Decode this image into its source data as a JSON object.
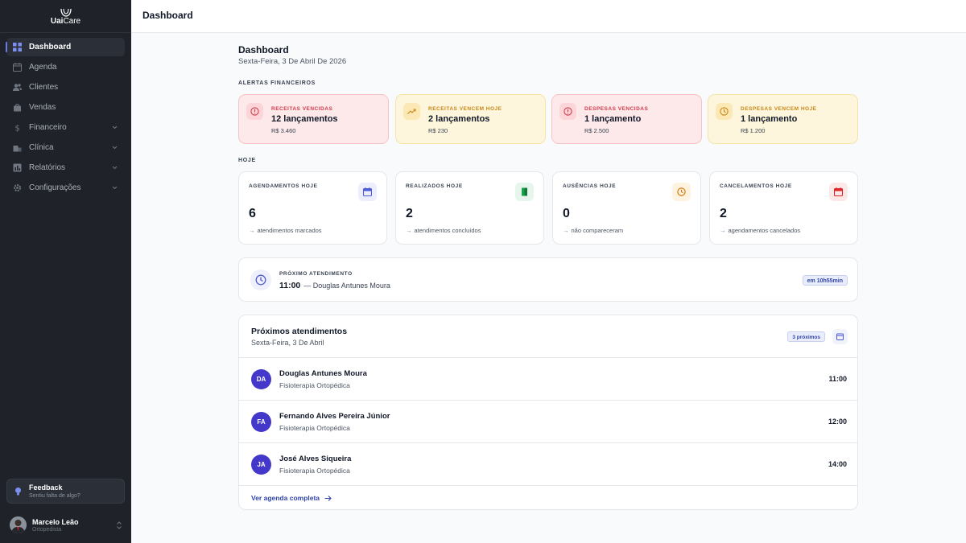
{
  "sidebar": {
    "logo": {
      "brand_bold": "Uai",
      "brand_light": "Care"
    },
    "items": [
      {
        "label": "Dashboard",
        "icon": "grid-icon"
      },
      {
        "label": "Agenda",
        "icon": "calendar-icon"
      },
      {
        "label": "Clientes",
        "icon": "users-icon"
      },
      {
        "label": "Vendas",
        "icon": "shopping-bag-icon"
      },
      {
        "label": "Financeiro",
        "icon": "dollar-icon"
      },
      {
        "label": "Clínica",
        "icon": "building-icon"
      },
      {
        "label": "Relatórios",
        "icon": "chart-icon"
      },
      {
        "label": "Configurações",
        "icon": "gear-icon"
      }
    ],
    "feedback": {
      "title": "Feedback",
      "subtitle": "Sentiu falta de algo?"
    },
    "user": {
      "name": "Marcelo Leão",
      "role": "Ortopedista"
    }
  },
  "header": {
    "title": "Dashboard"
  },
  "main": {
    "title": "Dashboard",
    "date": "Sexta-Feira, 3 De Abril De 2026",
    "alerts_label": "ALERTAS FINANCEIROS",
    "alerts": [
      {
        "label": "RECEITAS VENCIDAS",
        "count": "12 lançamentos",
        "amount": "R$ 3.460",
        "color": "#d23a4b"
      },
      {
        "label": "RECEITAS VENCEM HOJE",
        "count": "2 lançamentos",
        "amount": "R$ 230",
        "color": "#c78616"
      },
      {
        "label": "DESPESAS VENCIDAS",
        "count": "1 lançamento",
        "amount": "R$ 2.500",
        "color": "#d23a4b"
      },
      {
        "label": "DESPESAS VENCEM HOJE",
        "count": "1 lançamento",
        "amount": "R$ 1.200",
        "color": "#c78616"
      }
    ],
    "today_label": "HOJE",
    "stats": [
      {
        "label": "AGENDAMENTOS HOJE",
        "value": "6",
        "note": "atendimentos marcados",
        "icon": "calendar-icon",
        "color": "#4f5bd5"
      },
      {
        "label": "REALIZADOS HOJE",
        "value": "2",
        "note": "atendimentos concluídos",
        "icon": "door-icon",
        "color": "#16a34a"
      },
      {
        "label": "AUSÊNCIAS HOJE",
        "value": "0",
        "note": "não compareceram",
        "icon": "clock-icon",
        "color": "#d97706"
      },
      {
        "label": "CANCELAMENTOS HOJE",
        "value": "2",
        "note": "agendamentos cancelados",
        "icon": "calendar-x-icon",
        "color": "#dc2626"
      }
    ],
    "next": {
      "label": "PRÓXIMO ATENDIMENTO",
      "time": "11:00",
      "patient": "— Douglas Antunes Moura",
      "badge": "em 10h55min"
    },
    "upcoming": {
      "title": "Próximos atendimentos",
      "date": "Sexta-Feira, 3 De Abril",
      "badge": "3 próximos",
      "rows": [
        {
          "initials": "DA",
          "name": "Douglas Antunes Moura",
          "specialty": "Fisioterapia Ortopédica",
          "time": "11:00"
        },
        {
          "initials": "FA",
          "name": "Fernando Alves Pereira Júnior",
          "specialty": "Fisioterapia Ortopédica",
          "time": "12:00"
        },
        {
          "initials": "JA",
          "name": "José Alves Siqueira",
          "specialty": "Fisioterapia Ortopédica",
          "time": "14:00"
        }
      ],
      "link": "Ver agenda completa"
    }
  }
}
